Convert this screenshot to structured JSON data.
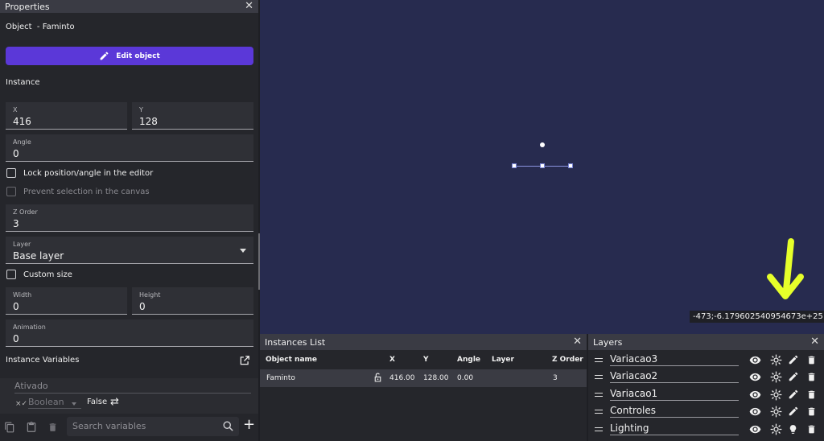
{
  "properties": {
    "title": "Properties",
    "object_prefix": "Object",
    "object_name": "Faminto",
    "edit_object_label": "Edit object",
    "instance_label": "Instance",
    "x_label": "X",
    "x_value": "416",
    "y_label": "Y",
    "y_value": "128",
    "angle_label": "Angle",
    "angle_value": "0",
    "lock_label": "Lock position/angle in the editor",
    "prevent_label": "Prevent selection in the canvas",
    "zorder_label": "Z Order",
    "zorder_value": "3",
    "layer_label": "Layer",
    "layer_value": "Base layer",
    "custom_size_label": "Custom size",
    "width_label": "Width",
    "width_value": "0",
    "height_label": "Height",
    "height_value": "0",
    "animation_label": "Animation",
    "animation_value": "0",
    "instance_variables_label": "Instance Variables",
    "variable": {
      "name": "Ativado",
      "type": "Boolean",
      "value": "False"
    },
    "search_placeholder": "Search variables"
  },
  "canvas": {
    "coordinates": "-473;-6.179602540954673e+25"
  },
  "instances": {
    "title": "Instances List",
    "columns": [
      "Object name",
      "X",
      "Y",
      "Angle",
      "Layer",
      "Z Order"
    ],
    "rows": [
      {
        "name": "Faminto",
        "x": "416.00",
        "y": "128.00",
        "angle": "0.00",
        "layer": "",
        "zorder": "3"
      }
    ]
  },
  "layers": {
    "title": "Layers",
    "items": [
      {
        "name": "Variacao3"
      },
      {
        "name": "Variacao2"
      },
      {
        "name": "Variacao1"
      },
      {
        "name": "Controles"
      },
      {
        "name": "Lighting"
      }
    ]
  },
  "colors": {
    "accent": "#5b38d8",
    "canvas": "#272b4f",
    "arrow": "#e6ff2a"
  }
}
